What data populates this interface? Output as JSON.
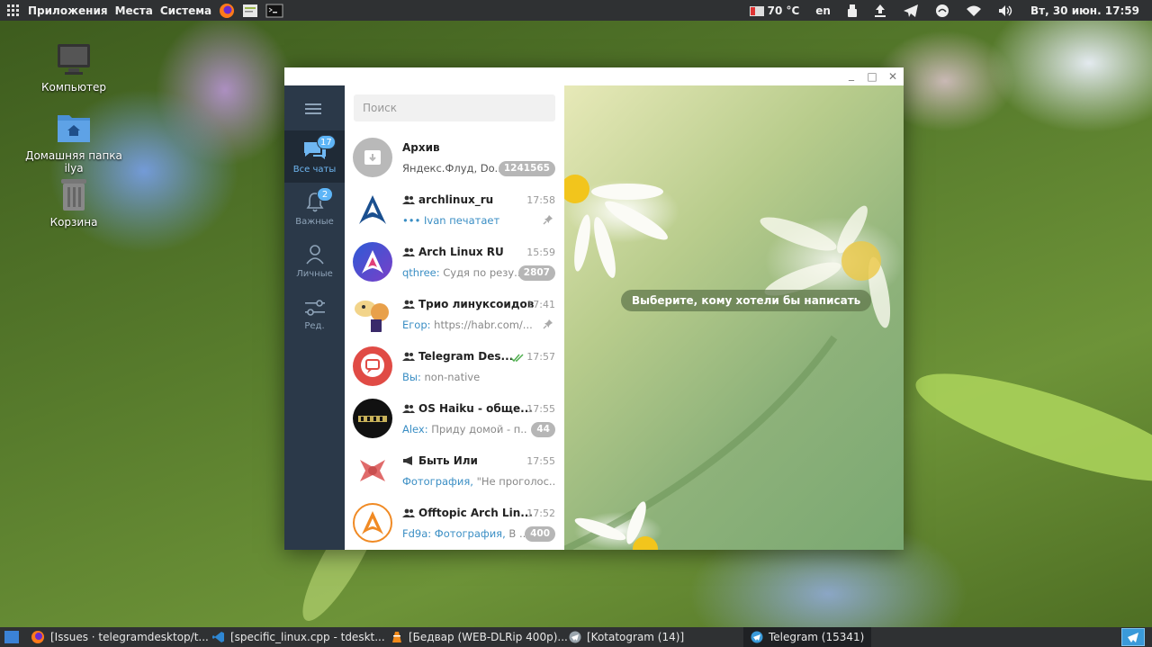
{
  "top_panel": {
    "menu_apps": "Приложения",
    "menu_places": "Места",
    "menu_system": "Система",
    "temperature": "70 °C",
    "keyboard_layout": "en",
    "clock": "Вт, 30 июн. 17:59"
  },
  "desktop": {
    "icons": [
      {
        "label": "Компьютер"
      },
      {
        "label": "Домашняя папка ilya"
      },
      {
        "label": "Корзина"
      }
    ]
  },
  "telegram": {
    "window_controls": {
      "minimize": "_",
      "maximize": "□",
      "close": "✕"
    },
    "folders": [
      {
        "label": "Все чаты",
        "badge": "17"
      },
      {
        "label": "Важные",
        "badge": "2"
      },
      {
        "label": "Личные"
      },
      {
        "label": "Ред."
      }
    ],
    "search": {
      "placeholder": "Поиск"
    },
    "chats": [
      {
        "name": "Архив",
        "sender": "",
        "message": "Яндекс.Флуд, Do...",
        "time": "",
        "badge": "1241565"
      },
      {
        "name": "archlinux_ru",
        "sender": "",
        "message": "••• Ivan печатает",
        "time": "17:58",
        "badge": ""
      },
      {
        "name": "Arch Linux RU",
        "sender": "qthree:",
        "message": " Судя по резу...",
        "time": "15:59",
        "badge": "2807"
      },
      {
        "name": "Трио линуксоидов",
        "sender": "Егор:",
        "message": " https://habr.com/...",
        "time": "17:41",
        "badge": ""
      },
      {
        "name": "Telegram Des...",
        "sender": "Вы:",
        "message": " non-native",
        "time": "17:57",
        "badge": ""
      },
      {
        "name": "OS Haiku - обще...",
        "sender": "Alex:",
        "message": " Приду домой - п...",
        "time": "17:55",
        "badge": "44"
      },
      {
        "name": "Быть Или",
        "sender": "Фотография,",
        "message": " \"Не проголос...",
        "time": "17:55",
        "badge": ""
      },
      {
        "name": "Offtopic Arch Lin...",
        "sender": "Fd9a: Фотография,",
        "message": " В ...",
        "time": "17:52",
        "badge": "400"
      }
    ],
    "empty_hint": "Выберите, кому хотели бы написать"
  },
  "taskbar": {
    "items": [
      {
        "label": "[Issues · telegramdesktop/t..."
      },
      {
        "label": "[specific_linux.cpp - tdeskt..."
      },
      {
        "label": "[Бедвар (WEB-DLRip 400p)..."
      },
      {
        "label": "[Kotatogram (14)]"
      },
      {
        "label": "Telegram (15341)"
      }
    ]
  }
}
